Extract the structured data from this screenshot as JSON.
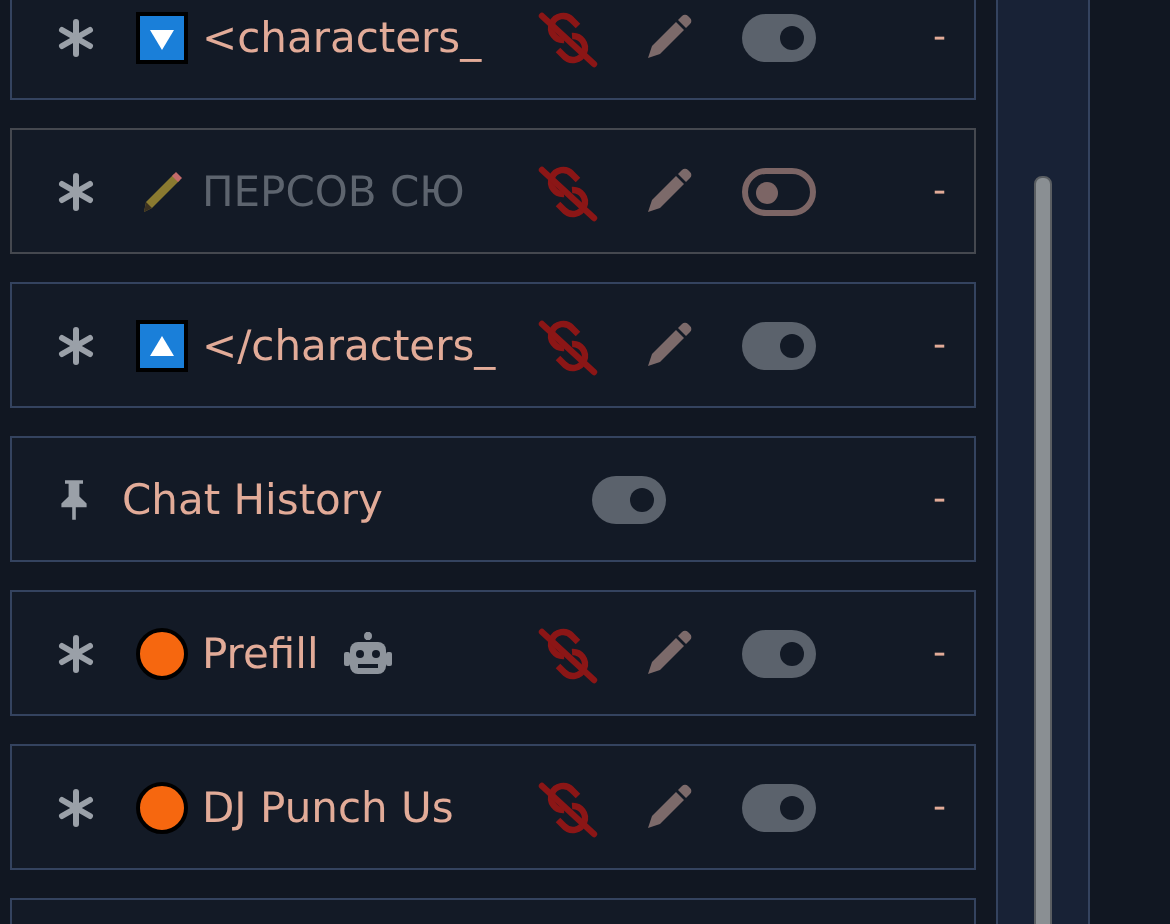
{
  "entries": [
    {
      "kind": "prompt",
      "badge": {
        "kind": "down"
      },
      "name": "<characters_",
      "on": true,
      "bot": false,
      "tokens": "-"
    },
    {
      "kind": "prompt",
      "badge": {
        "kind": "pencil"
      },
      "name": "ПЕРСОВ СЮ",
      "on": false,
      "bot": false,
      "tokens": "-"
    },
    {
      "kind": "prompt",
      "badge": {
        "kind": "up"
      },
      "name": "</characters_",
      "on": true,
      "bot": false,
      "tokens": "-"
    },
    {
      "kind": "marker",
      "name": "Chat History",
      "on": true,
      "bot": false,
      "tokens": "-"
    },
    {
      "kind": "prompt",
      "badge": {
        "kind": "dot",
        "color": "#f6670f"
      },
      "name": "Prefill",
      "on": true,
      "bot": true,
      "tokens": "-"
    },
    {
      "kind": "prompt",
      "badge": {
        "kind": "dot",
        "color": "#f6670f"
      },
      "name": "DJ Punch Us",
      "on": true,
      "bot": false,
      "tokens": "-"
    }
  ]
}
